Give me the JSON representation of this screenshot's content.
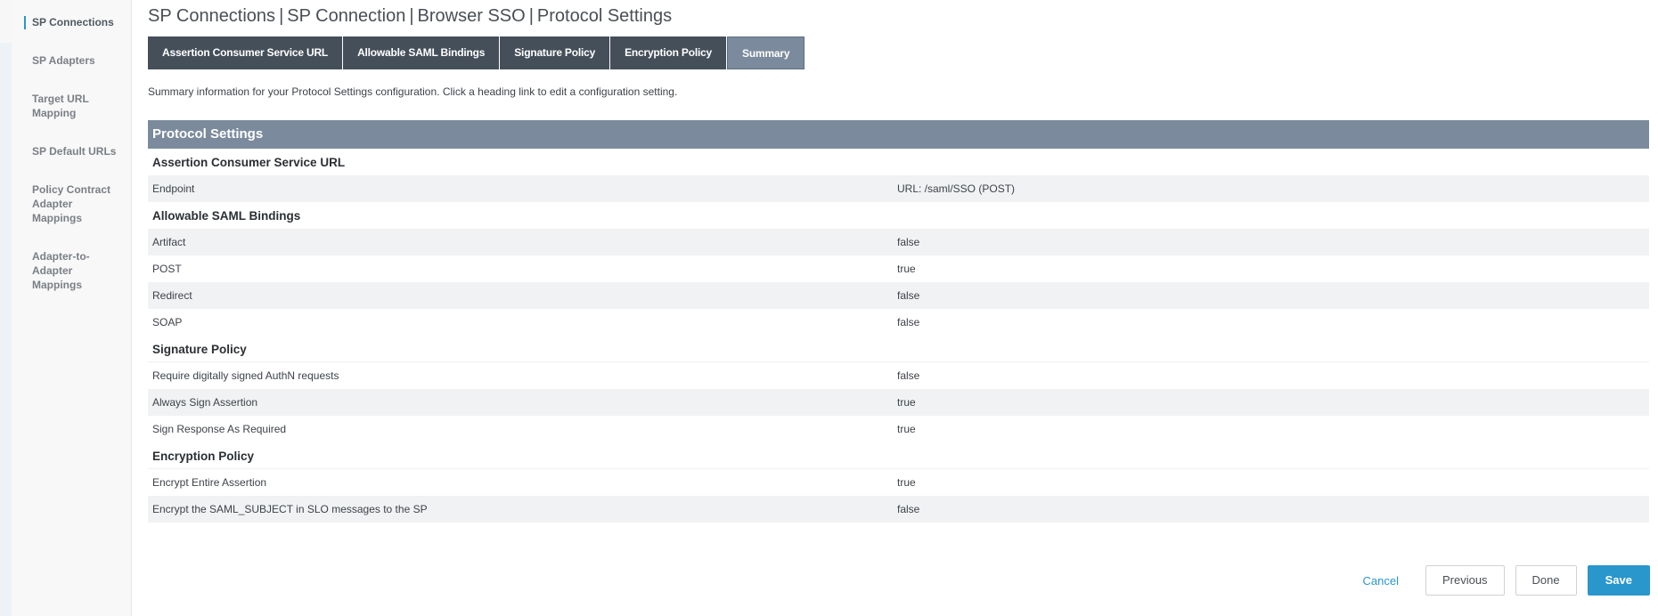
{
  "sidebar": {
    "items": [
      {
        "label": "SP Connections",
        "active": true
      },
      {
        "label": "SP Adapters",
        "active": false
      },
      {
        "label": "Target URL Mapping",
        "active": false
      },
      {
        "label": "SP Default URLs",
        "active": false
      },
      {
        "label": "Policy Contract Adapter Mappings",
        "active": false
      },
      {
        "label": "Adapter-to-Adapter Mappings",
        "active": false
      }
    ]
  },
  "breadcrumb": [
    "SP Connections",
    "SP Connection",
    "Browser SSO",
    "Protocol Settings"
  ],
  "tabs": [
    {
      "label": "Assertion Consumer Service URL",
      "active": false
    },
    {
      "label": "Allowable SAML Bindings",
      "active": false
    },
    {
      "label": "Signature Policy",
      "active": false
    },
    {
      "label": "Encryption Policy",
      "active": false
    },
    {
      "label": "Summary",
      "active": true
    }
  ],
  "intro": "Summary information for your Protocol Settings configuration. Click a heading link to edit a configuration setting.",
  "summary": {
    "header": "Protocol Settings",
    "sections": [
      {
        "heading": "Assertion Consumer Service URL",
        "rows": [
          {
            "label": "Endpoint",
            "value": "URL: /saml/SSO (POST)"
          }
        ]
      },
      {
        "heading": "Allowable SAML Bindings",
        "rows": [
          {
            "label": "Artifact",
            "value": "false"
          },
          {
            "label": "POST",
            "value": "true"
          },
          {
            "label": "Redirect",
            "value": "false"
          },
          {
            "label": "SOAP",
            "value": "false"
          }
        ]
      },
      {
        "heading": "Signature Policy",
        "rows": [
          {
            "label": "Require digitally signed AuthN requests",
            "value": "false"
          },
          {
            "label": "Always Sign Assertion",
            "value": "true"
          },
          {
            "label": "Sign Response As Required",
            "value": "true"
          }
        ]
      },
      {
        "heading": "Encryption Policy",
        "rows": [
          {
            "label": "Encrypt Entire Assertion",
            "value": "true"
          },
          {
            "label": "Encrypt the SAML_SUBJECT in SLO messages to the SP",
            "value": "false"
          }
        ]
      }
    ]
  },
  "footer": {
    "cancel": "Cancel",
    "previous": "Previous",
    "done": "Done",
    "save": "Save"
  },
  "colors": {
    "accent": "#2996cc",
    "tab_dark": "#454f5a",
    "tab_active": "#7b8b9d",
    "summary_header": "#7b8b9d"
  }
}
